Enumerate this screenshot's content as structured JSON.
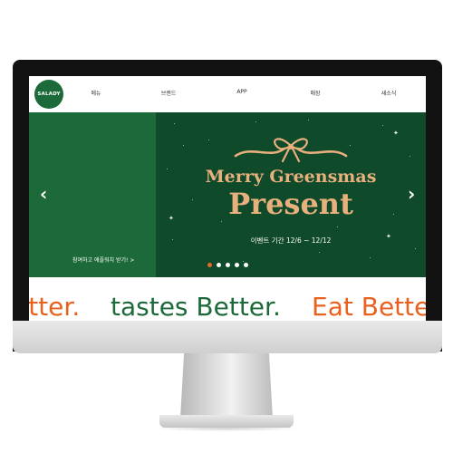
{
  "nav": {
    "logo_text": "SALADY",
    "items": [
      {
        "label": "메뉴"
      },
      {
        "label": "브랜드"
      },
      {
        "label": "APP"
      },
      {
        "label": "매장"
      },
      {
        "label": "새소식"
      }
    ]
  },
  "hero": {
    "left_caption": "참여하고 애플워치 받기! >",
    "promo_title_line1": "Merry Greensmas",
    "promo_title_line2": "Present",
    "promo_period": "이벤트 기간  12/6 ~ 12/12",
    "prev_arrow": "‹",
    "next_arrow": "›",
    "slide_count": 5,
    "active_slide": 1
  },
  "slogans": [
    {
      "text": "etter.",
      "color": "#e8621e"
    },
    {
      "text": "tastes Better.",
      "color": "#1c6a3a"
    },
    {
      "text": "Eat Bette",
      "color": "#e8621e"
    }
  ],
  "colors": {
    "brand_green": "#1c6a3a",
    "banner_dark_green": "#0f4a2a",
    "promo_gold": "#e8b07c",
    "accent_orange": "#e46a2a"
  }
}
